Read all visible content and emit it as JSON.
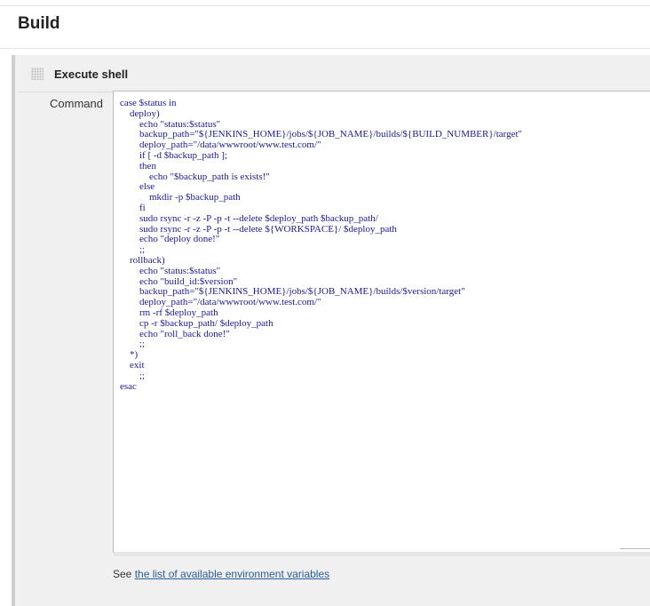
{
  "section_title": "Build",
  "step": {
    "title": "Execute shell",
    "command_label": "Command",
    "command_lines": [
      "case $status in",
      "    deploy)",
      "        echo \"status:$status\"",
      "        backup_path=\"${JENKINS_HOME}/jobs/${JOB_NAME}/builds/${BUILD_NUMBER}/target\"",
      "        deploy_path=\"/data/wwwroot/www.test.com/\"",
      "        if [ -d $backup_path ];",
      "        then",
      "            echo \"$backup_path is exists!\"",
      "        else",
      "            mkdir -p $backup_path",
      "        fi",
      "        sudo rsync -r -z -P -p -t --delete $deploy_path $backup_path/",
      "        sudo rsync -r -z -P -p -t --delete ${WORKSPACE}/ $deploy_path",
      "        echo \"deploy done!\"",
      "        ;;",
      "    rollback)",
      "        echo \"status:$status\"",
      "        echo \"build_id:$version\"",
      "        backup_path=\"${JENKINS_HOME}/jobs/${JOB_NAME}/builds/$version/target\"",
      "        deploy_path=\"/data/wwwroot/www.test.com/\"",
      "        rm -rf $deploy_path",
      "        cp -r $backup_path/ $deploy_path",
      "        echo \"roll_back done!\"",
      "        ;;",
      "    *)",
      "    exit",
      "        ;;",
      "esac"
    ],
    "help_prefix": "See ",
    "help_link": "the list of available environment variables"
  }
}
